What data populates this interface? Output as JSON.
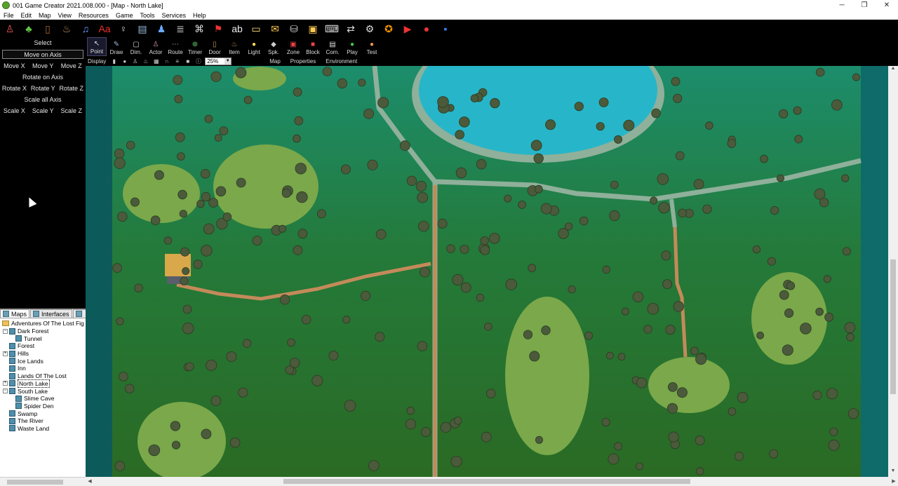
{
  "window": {
    "title": "001 Game Creator 2021.008.000 - [Map - North Lake]",
    "minimize": "─",
    "restore": "❐",
    "close": "✕"
  },
  "menu": [
    "File",
    "Edit",
    "Map",
    "View",
    "Resources",
    "Game",
    "Tools",
    "Services",
    "Help"
  ],
  "toolbar_icons": [
    "actor-icon",
    "leaf-icon",
    "door-icon",
    "bag-icon",
    "music-icon",
    "font-icon",
    "figure-icon",
    "page-icon",
    "group-icon",
    "list-icon",
    "network-icon",
    "flag-icon",
    "abc-icon",
    "dialog-icon",
    "scroll-icon",
    "database-icon",
    "window-icon",
    "controller-icon",
    "switch-icon",
    "gear-icon",
    "medal-icon",
    "film-icon",
    "record-icon",
    "save-icon"
  ],
  "left_panel": {
    "select": "Select",
    "move_on_axis": "Move on Axis",
    "move": [
      "Move X",
      "Move Y",
      "Move Z"
    ],
    "rotate_on_axis": "Rotate on Axis",
    "rotate": [
      "Rotate X",
      "Rotate Y",
      "Rotate Z"
    ],
    "scale_all_axis": "Scale all Axis",
    "scale": [
      "Scale X",
      "Scale Y",
      "Scale Z"
    ]
  },
  "tabs": {
    "maps": "Maps",
    "interfaces": "Interfaces"
  },
  "tree": {
    "root": "Adventures Of The Lost Fig",
    "items": [
      {
        "label": "Dark Forest",
        "level": 1,
        "expand": "−"
      },
      {
        "label": "Tunnel",
        "level": 2,
        "expand": ""
      },
      {
        "label": "Forest",
        "level": 1,
        "expand": ""
      },
      {
        "label": "Hills",
        "level": 1,
        "expand": "+"
      },
      {
        "label": "Ice Lands",
        "level": 1,
        "expand": ""
      },
      {
        "label": "Inn",
        "level": 1,
        "expand": ""
      },
      {
        "label": "Lands Of The Lost",
        "level": 1,
        "expand": ""
      },
      {
        "label": "North Lake",
        "level": 1,
        "expand": "+",
        "selected": true
      },
      {
        "label": "South Lake",
        "level": 1,
        "expand": "−"
      },
      {
        "label": "Slime Cave",
        "level": 2,
        "expand": ""
      },
      {
        "label": "Spider Den",
        "level": 2,
        "expand": ""
      },
      {
        "label": "Swamp",
        "level": 1,
        "expand": ""
      },
      {
        "label": "The River",
        "level": 1,
        "expand": ""
      },
      {
        "label": "Waste Land",
        "level": 1,
        "expand": ""
      }
    ]
  },
  "tools": [
    {
      "label": "Point",
      "icon": "↖",
      "active": true
    },
    {
      "label": "Draw",
      "icon": "✎"
    },
    {
      "label": "Dim.",
      "icon": "▢"
    },
    {
      "label": "Actor",
      "icon": "♙"
    },
    {
      "label": "Route",
      "icon": "⋯"
    },
    {
      "label": "Timer",
      "icon": "⊕"
    },
    {
      "label": "Door",
      "icon": "▯"
    },
    {
      "label": "Item",
      "icon": "♨"
    },
    {
      "label": "Light",
      "icon": "●"
    },
    {
      "label": "Spk.",
      "icon": "◆"
    },
    {
      "label": "Zone",
      "icon": "▣"
    },
    {
      "label": "Block",
      "icon": "■"
    },
    {
      "label": "Com.",
      "icon": "▤"
    },
    {
      "label": "Play",
      "icon": "●"
    },
    {
      "label": "Test",
      "icon": "●"
    }
  ],
  "display": {
    "label": "Display",
    "zoom": "25%",
    "sections": [
      "Map",
      "Properties",
      "Environment"
    ]
  },
  "colors": {
    "grass": "#2f7a3a",
    "grass_dark": "#2d6b2a",
    "meadow": "#7aa84a",
    "lake": "#27b6c9",
    "path": "#c48a5a",
    "road": "#8fb09a",
    "roof": "#d9a84a",
    "tree": "#4a5a3a",
    "void": "#0d5a5a"
  }
}
